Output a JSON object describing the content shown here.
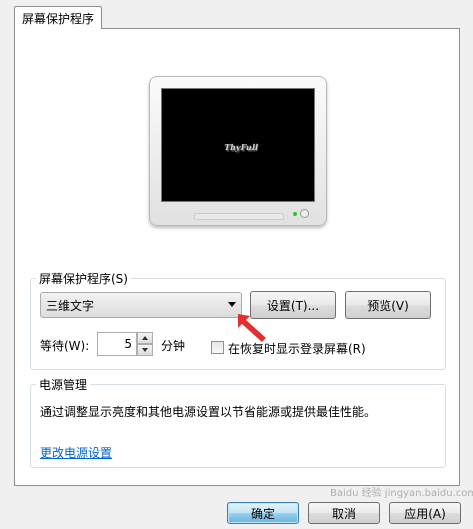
{
  "tab": {
    "label": "屏幕保护程序"
  },
  "preview": {
    "screen_text": "ThyFull"
  },
  "screensaver": {
    "group_label": "屏幕保护程序(S)",
    "selected": "三维文字",
    "settings_button": "设置(T)...",
    "preview_button": "预览(V)",
    "wait_label": "等待(W):",
    "wait_value": "5",
    "wait_unit": "分钟",
    "resume_checkbox_label": "在恢复时显示登录屏幕(R)",
    "resume_checked": false
  },
  "power": {
    "group_label": "电源管理",
    "description": "通过调整显示亮度和其他电源设置以节省能源或提供最佳性能。",
    "link": "更改电源设置"
  },
  "footer": {
    "ok": "确定",
    "cancel": "取消",
    "apply": "应用(A)"
  },
  "colors": {
    "annotation_arrow": "#e03030",
    "link": "#0066cc"
  },
  "watermark": "Baidu 经验 jingyan.baidu.com"
}
